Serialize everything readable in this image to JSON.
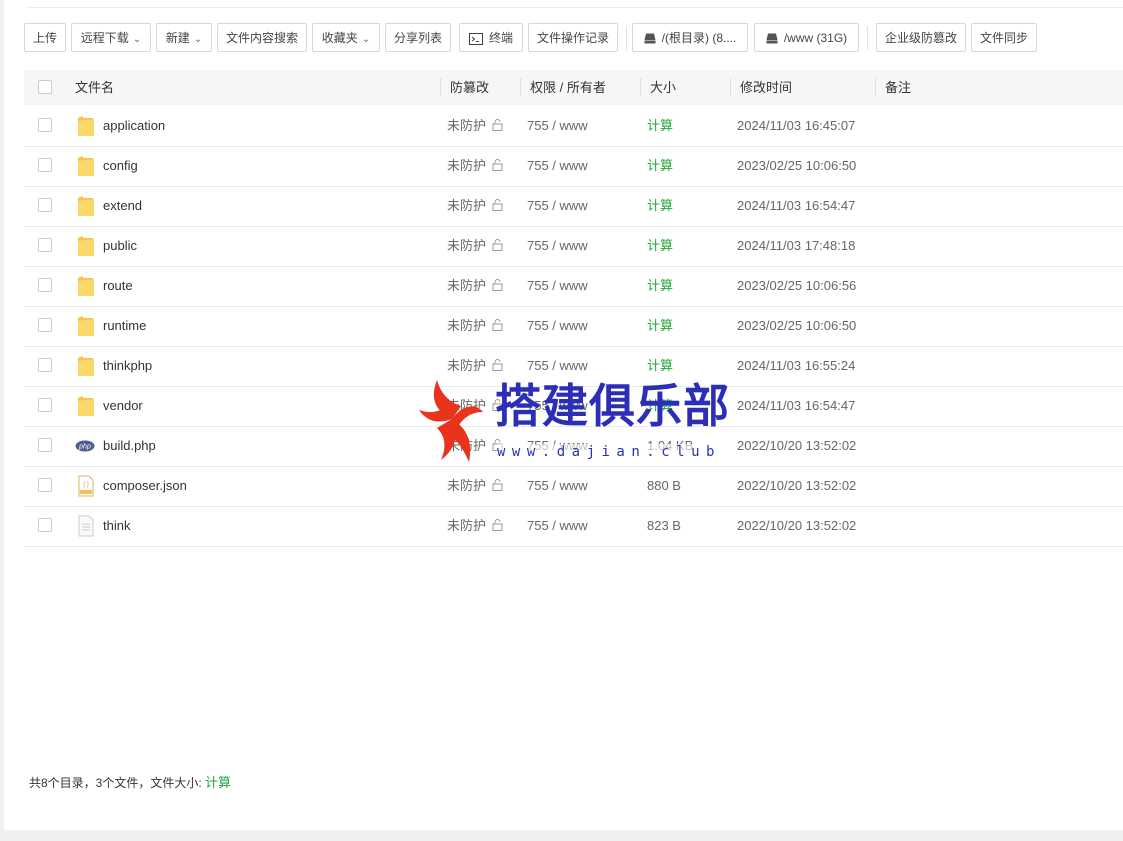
{
  "toolbar": {
    "upload": "上传",
    "remote_download": "远程下载",
    "new": "新建",
    "content_search": "文件内容搜索",
    "favorites": "收藏夹",
    "share_list": "分享列表",
    "terminal": "终端",
    "operation_log": "文件操作记录",
    "disk_root": "/(根目录) (8....",
    "disk_www": "/www (31G)",
    "enterprise_tamper": "企业级防篡改",
    "file_sync": "文件同步"
  },
  "table": {
    "headers": {
      "name": "文件名",
      "tamper": "防篡改",
      "perm": "权限 / 所有者",
      "size": "大小",
      "mtime": "修改时间",
      "note": "备注"
    },
    "rows": [
      {
        "name": "application",
        "icon": "folder-icon",
        "tamper": "未防护",
        "perm": "755 / www",
        "size": "计算",
        "mtime": "2024/11/03 16:45:07"
      },
      {
        "name": "config",
        "icon": "folder-icon",
        "tamper": "未防护",
        "perm": "755 / www",
        "size": "计算",
        "mtime": "2023/02/25 10:06:50"
      },
      {
        "name": "extend",
        "icon": "folder-icon",
        "tamper": "未防护",
        "perm": "755 / www",
        "size": "计算",
        "mtime": "2024/11/03 16:54:47"
      },
      {
        "name": "public",
        "icon": "folder-icon",
        "tamper": "未防护",
        "perm": "755 / www",
        "size": "计算",
        "mtime": "2024/11/03 17:48:18"
      },
      {
        "name": "route",
        "icon": "folder-icon",
        "tamper": "未防护",
        "perm": "755 / www",
        "size": "计算",
        "mtime": "2023/02/25 10:06:56"
      },
      {
        "name": "runtime",
        "icon": "folder-icon",
        "tamper": "未防护",
        "perm": "755 / www",
        "size": "计算",
        "mtime": "2023/02/25 10:06:50"
      },
      {
        "name": "thinkphp",
        "icon": "folder-icon",
        "tamper": "未防护",
        "perm": "755 / www",
        "size": "计算",
        "mtime": "2024/11/03 16:55:24"
      },
      {
        "name": "vendor",
        "icon": "folder-icon",
        "tamper": "未防护",
        "perm": "755 / www",
        "size": "计算",
        "mtime": "2024/11/03 16:54:47"
      },
      {
        "name": "build.php",
        "icon": "php-file-icon",
        "tamper": "未防护",
        "perm": "755 / www",
        "size": "1.04 KB",
        "mtime": "2022/10/20 13:52:02"
      },
      {
        "name": "composer.json",
        "icon": "json-file-icon",
        "tamper": "未防护",
        "perm": "755 / www",
        "size": "880 B",
        "mtime": "2022/10/20 13:52:02"
      },
      {
        "name": "think",
        "icon": "text-file-icon",
        "tamper": "未防护",
        "perm": "755 / www",
        "size": "823 B",
        "mtime": "2022/10/20 13:52:02"
      }
    ]
  },
  "footer": {
    "summary": "共8个目录，3个文件，文件大小:",
    "calc": "计算"
  },
  "watermark": {
    "brand": "搭建俱乐部",
    "url": "www.dajian.club"
  },
  "colors": {
    "accent_green": "#20a53a",
    "folder_yellow": "#f7c948",
    "watermark_blue": "#2b2fb8",
    "watermark_red": "#e8341c"
  }
}
